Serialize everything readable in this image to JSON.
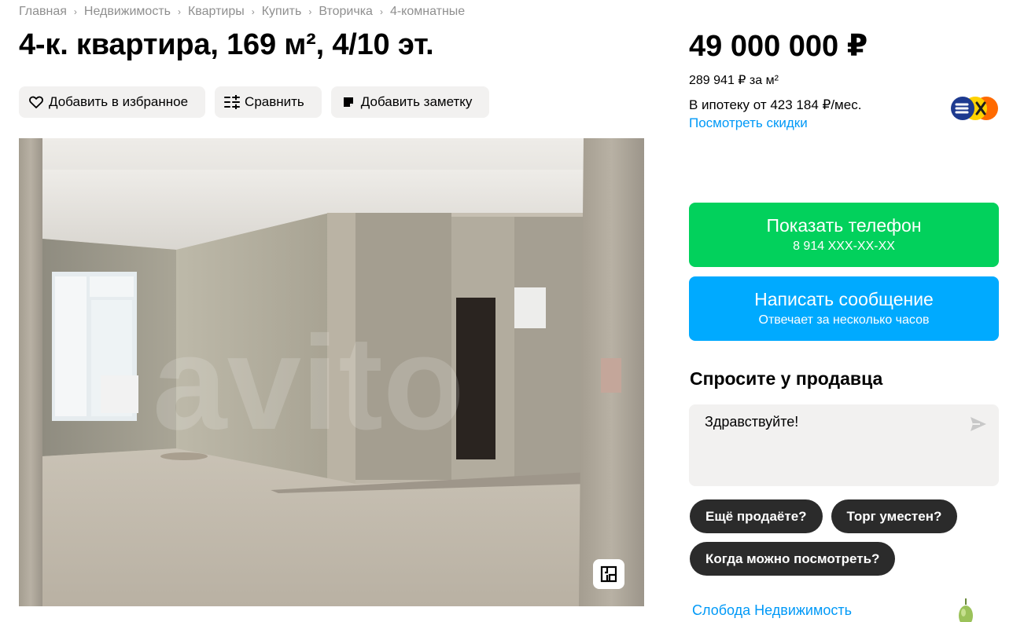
{
  "breadcrumbs": [
    "Главная",
    "Недвижимость",
    "Квартиры",
    "Купить",
    "Вторичка",
    "4-комнатные"
  ],
  "listing": {
    "title": "4-к. квартира, 169 м², 4/10 эт.",
    "price": "49 000 000 ₽",
    "price_per_m2": "289 941 ₽ за м²",
    "mortgage": "В ипотеку от 423 184 ₽/мес.",
    "discounts_link": "Посмотреть скидки"
  },
  "actions": {
    "favorite": "Добавить в избранное",
    "compare": "Сравнить",
    "note": "Добавить заметку"
  },
  "contact": {
    "phone_label": "Показать телефон",
    "phone_masked": "8 914 XXX-XX-XX",
    "message_label": "Написать сообщение",
    "message_sub": "Отвечает за несколько часов"
  },
  "ask": {
    "title": "Спросите у продавца",
    "message_value": "Здравствуйте!",
    "chips": [
      "Ещё продаёте?",
      "Торг уместен?",
      "Когда можно посмотреть?"
    ]
  },
  "seller": {
    "name": "Слобода Недвижимость"
  },
  "photo": {
    "watermark": "avito"
  },
  "icons": {
    "favorite": "heart-icon",
    "compare": "compare-icon",
    "note": "note-icon",
    "send": "send-icon",
    "plan": "floor-plan-icon",
    "bank": "bank-logo-icon"
  },
  "colors": {
    "green": "#02d15c",
    "blue": "#00aaff",
    "link": "#0099f7",
    "chip": "#2b2b2b",
    "button_bg": "#f2f1f0"
  }
}
